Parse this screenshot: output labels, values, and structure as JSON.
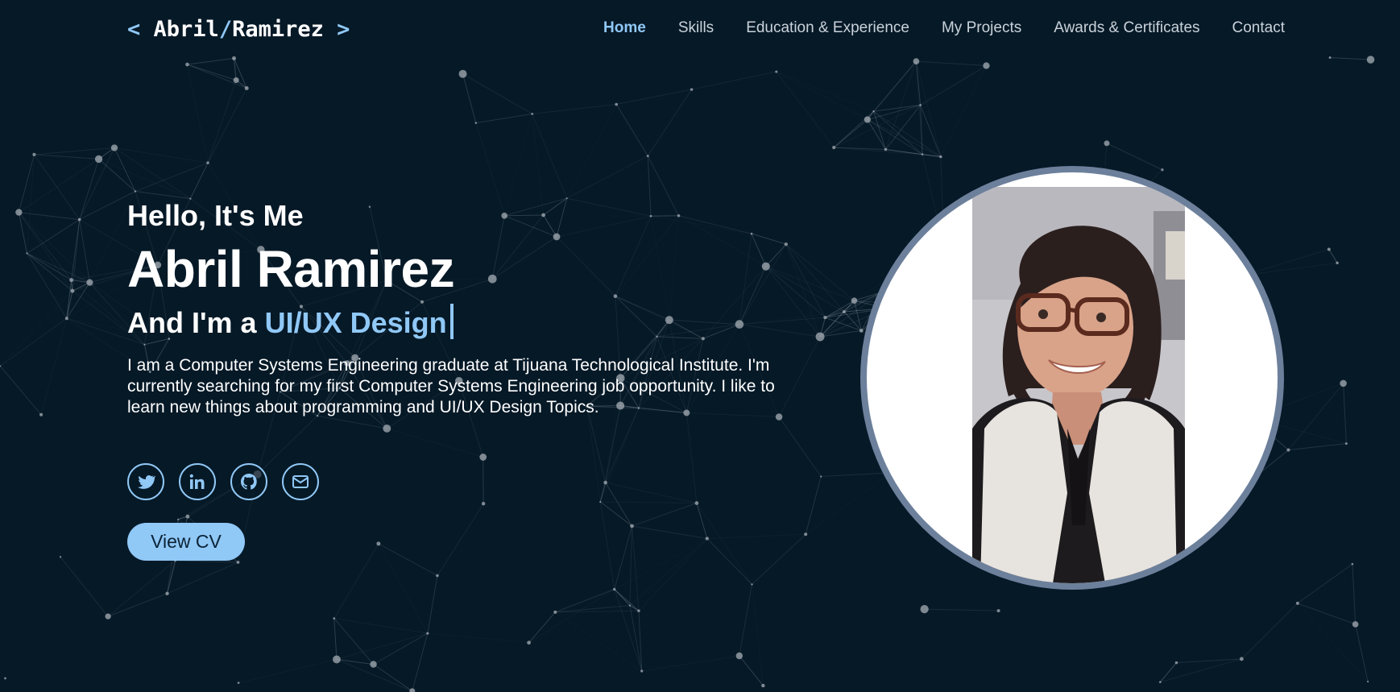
{
  "header": {
    "logo": {
      "open": "<",
      "first": "Abril",
      "slash": "/",
      "last": "Ramirez",
      "close": ">"
    },
    "nav": [
      {
        "label": "Home",
        "active": true
      },
      {
        "label": "Skills",
        "active": false
      },
      {
        "label": "Education & Experience",
        "active": false
      },
      {
        "label": "My Projects",
        "active": false
      },
      {
        "label": "Awards & Certificates",
        "active": false
      },
      {
        "label": "Contact",
        "active": false
      }
    ]
  },
  "hero": {
    "greeting": "Hello, It's Me",
    "name": "Abril Ramirez",
    "role_prefix": "And I'm a ",
    "role_typed": "UI/UX Design",
    "bio": "I am a Computer Systems Engineering graduate at Tijuana Technological Institute. I'm currently searching for my first Computer Systems Engineering job opportunity. I like to learn new things about programming and UI/UX Design Topics.",
    "socials": [
      {
        "icon": "twitter-icon"
      },
      {
        "icon": "linkedin-icon"
      },
      {
        "icon": "github-icon"
      },
      {
        "icon": "mail-icon"
      }
    ],
    "cv_button": "View CV"
  },
  "colors": {
    "background": "#061927",
    "accent": "#90c8f6",
    "ring": "#6c809c",
    "nav_text": "#c9d2da"
  }
}
